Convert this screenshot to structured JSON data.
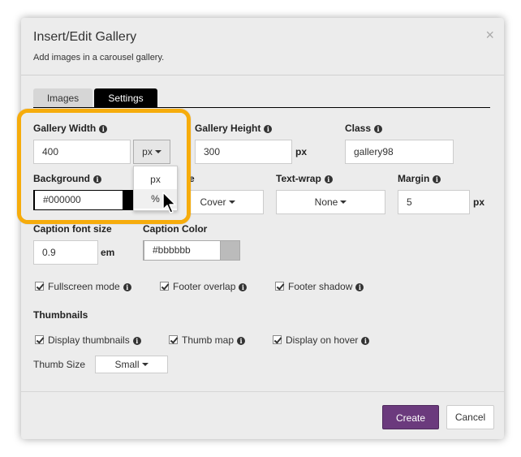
{
  "dialog": {
    "title": "Insert/Edit Gallery",
    "subtitle": "Add images in a carousel gallery.",
    "close_label": "×"
  },
  "tabs": [
    {
      "label": "Images",
      "active": false
    },
    {
      "label": "Settings",
      "active": true
    }
  ],
  "settings": {
    "gallery_width": {
      "label": "Gallery Width",
      "value": "400",
      "unit_button": "px"
    },
    "gallery_height": {
      "label": "Gallery Height",
      "value": "300",
      "unit": "px"
    },
    "class": {
      "label": "Class",
      "value": "gallery98"
    },
    "background": {
      "label": "Background",
      "value": "#000000",
      "swatch_color": "#000000"
    },
    "background_size": {
      "label_fragment": "e",
      "value": "Cover"
    },
    "text_wrap": {
      "label": "Text-wrap",
      "value": "None"
    },
    "margin": {
      "label": "Margin",
      "value": "5",
      "unit": "px"
    },
    "caption_font_size": {
      "label": "Caption font size",
      "value": "0.9",
      "unit": "em"
    },
    "caption_color": {
      "label": "Caption Color",
      "value": "#bbbbbb",
      "swatch_color": "#bbbbbb"
    },
    "options": {
      "fullscreen_mode": "Fullscreen mode",
      "footer_overlap": "Footer overlap",
      "footer_shadow": "Footer shadow"
    }
  },
  "thumbnails": {
    "heading": "Thumbnails",
    "display_thumbnails": "Display thumbnails",
    "thumb_map": "Thumb map",
    "display_on_hover": "Display on hover",
    "thumb_size_label": "Thumb Size",
    "thumb_size_value": "Small"
  },
  "unit_dropdown": {
    "options": [
      "px",
      "%"
    ],
    "hovered": "%"
  },
  "footer": {
    "create_label": "Create",
    "cancel_label": "Cancel"
  },
  "colors": {
    "accent_purple": "#6b3a7d",
    "highlight_orange": "#f6ac0c",
    "active_tab": "#000000"
  },
  "icons": {
    "info": "info-icon",
    "close": "close-icon",
    "cursor": "mouse-pointer-icon",
    "caret": "caret-down-icon",
    "checkbox": "checkmark-icon"
  }
}
